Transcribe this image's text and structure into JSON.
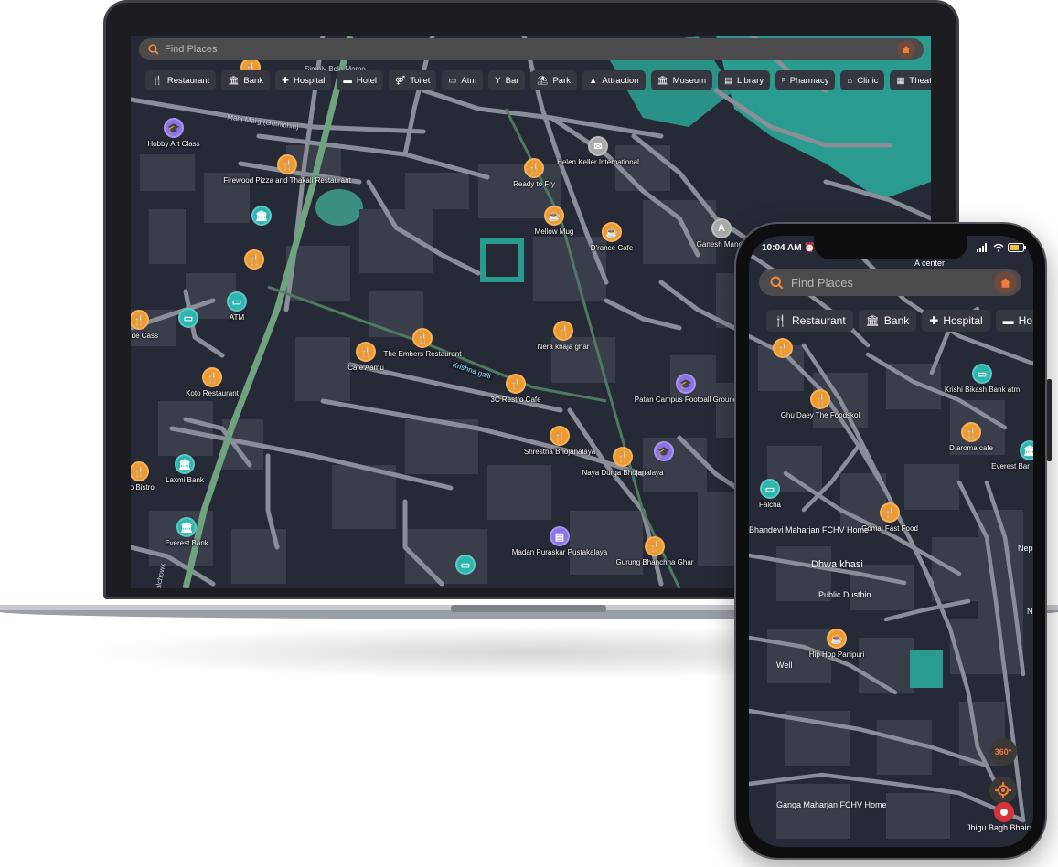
{
  "laptop": {
    "search": {
      "placeholder": "Find Places"
    },
    "chips": [
      "Restaurant",
      "Bank",
      "Hospital",
      "Hotel",
      "Toilet",
      "Atm",
      "Bar",
      "Park",
      "Attraction",
      "Museum",
      "Library",
      "Pharmacy",
      "Clinic",
      "Theater"
    ],
    "chip_icons": [
      "fork-knife-icon",
      "bank-icon",
      "plus-icon",
      "bed-icon",
      "restroom-icon",
      "atm-card-icon",
      "cocktail-icon",
      "park-icon",
      "attraction-icon",
      "museum-icon",
      "library-icon",
      "pharmacy-icon",
      "clinic-icon",
      "theater-icon"
    ],
    "street_labels": [
      "Simply Bola Momo",
      "Mahi Marg (Guthichin)",
      "Krishna galli",
      "Pulchowk"
    ],
    "pois": [
      {
        "label": "Hobby Art Class",
        "color": "purple",
        "icon": "graduation-cap-icon"
      },
      {
        "label": "Firewood Pizza and Thakali Restaurant",
        "color": "orange",
        "icon": "fork-knife-icon"
      },
      {
        "label": "",
        "color": "teal",
        "icon": "bank-icon"
      },
      {
        "label": "",
        "color": "orange",
        "icon": "fork-knife-icon"
      },
      {
        "label": "ATM",
        "color": "teal",
        "icon": "atm-card-icon"
      },
      {
        "label": "",
        "color": "teal",
        "icon": "atm-card-icon"
      },
      {
        "label": "a de Cass",
        "color": "orange",
        "icon": "fork-knife-icon"
      },
      {
        "label": "Koto Restaurant",
        "color": "orange",
        "icon": "fork-knife-icon"
      },
      {
        "label": "Laxmi Bank",
        "color": "teal",
        "icon": "bank-icon"
      },
      {
        "label": "bo Bistro",
        "color": "orange",
        "icon": "fork-knife-icon"
      },
      {
        "label": "Everest Bank",
        "color": "teal",
        "icon": "bank-icon"
      },
      {
        "label": "Cafe Aamu",
        "color": "orange",
        "icon": "fork-knife-icon"
      },
      {
        "label": "The Embers Restaurant",
        "color": "orange",
        "icon": "fork-knife-icon"
      },
      {
        "label": "3C Restro Cafe",
        "color": "orange",
        "icon": "fork-knife-icon"
      },
      {
        "label": "Ready to Fry",
        "color": "orange",
        "icon": "fork-knife-icon"
      },
      {
        "label": "Helen Keller International",
        "color": "gray",
        "icon": "mail-icon"
      },
      {
        "label": "Mellow Mug",
        "color": "orange",
        "icon": "coffee-icon"
      },
      {
        "label": "D'rance Cafe",
        "color": "orange",
        "icon": "coffee-icon"
      },
      {
        "label": "Ganesh Mandir",
        "color": "gray",
        "icon": "attraction-icon"
      },
      {
        "label": "Nera khaja ghar",
        "color": "orange",
        "icon": "fork-knife-icon"
      },
      {
        "label": "Patan Campus Football Ground",
        "color": "purple",
        "icon": "graduation-cap-icon"
      },
      {
        "label": "Shrestha Bhojanalaya",
        "color": "orange",
        "icon": "fork-knife-icon"
      },
      {
        "label": "Naya Durga Bhojanalaya",
        "color": "orange",
        "icon": "fork-knife-icon"
      },
      {
        "label": "",
        "color": "purple",
        "icon": "graduation-cap-icon"
      },
      {
        "label": "Madan Puraskar Pustakalaya",
        "color": "purple",
        "icon": "library-icon"
      },
      {
        "label": "",
        "color": "teal",
        "icon": "atm-card-icon"
      },
      {
        "label": "Gurung Bhanchha Ghar",
        "color": "orange",
        "icon": "fork-knife-icon"
      },
      {
        "label": "",
        "color": "orange",
        "icon": "fork-knife-icon"
      }
    ]
  },
  "phone": {
    "status": {
      "time": "10:04 AM",
      "time_icon": "alarm-clock-icon"
    },
    "top_label": "A center",
    "search": {
      "placeholder": "Find Places"
    },
    "chips": [
      "Restaurant",
      "Bank",
      "Hospital",
      "Ho"
    ],
    "chip_icons": [
      "fork-knife-icon",
      "bank-icon",
      "plus-icon",
      "bed-icon"
    ],
    "pois": [
      {
        "label": "",
        "color": "orange",
        "icon": "fork-knife-icon"
      },
      {
        "label": "Krishi Bikash Bank atm",
        "color": "teal",
        "icon": "atm-card-icon"
      },
      {
        "label": "Ghu Daey The Foodskol",
        "color": "orange",
        "icon": "fork-knife-icon"
      },
      {
        "label": "D.aroma cafe",
        "color": "orange",
        "icon": "fork-knife-icon"
      },
      {
        "label": "Everest Bar",
        "color": "teal",
        "icon": "bank-icon"
      },
      {
        "label": "Falcha",
        "color": "teal",
        "icon": "atm-card-icon"
      },
      {
        "label": "Gomal Fast Food",
        "color": "orange",
        "icon": "fork-knife-icon"
      },
      {
        "label": "Hip Hop Panipuri",
        "color": "orange",
        "icon": "coffee-icon"
      }
    ],
    "texts": [
      "Bhandevi Maharjan FCHV Home",
      "Dhwa khasi",
      "Public Dustbin",
      "Well",
      "Ganga Maharjan FCHV Home",
      "Jhigu Bagh Bhairab Polyclinic",
      "Nep The",
      "N"
    ],
    "fab_360": "360°",
    "fab_locate_icon": "locate-crosshair-icon",
    "fab_record_icon": "record-icon"
  }
}
